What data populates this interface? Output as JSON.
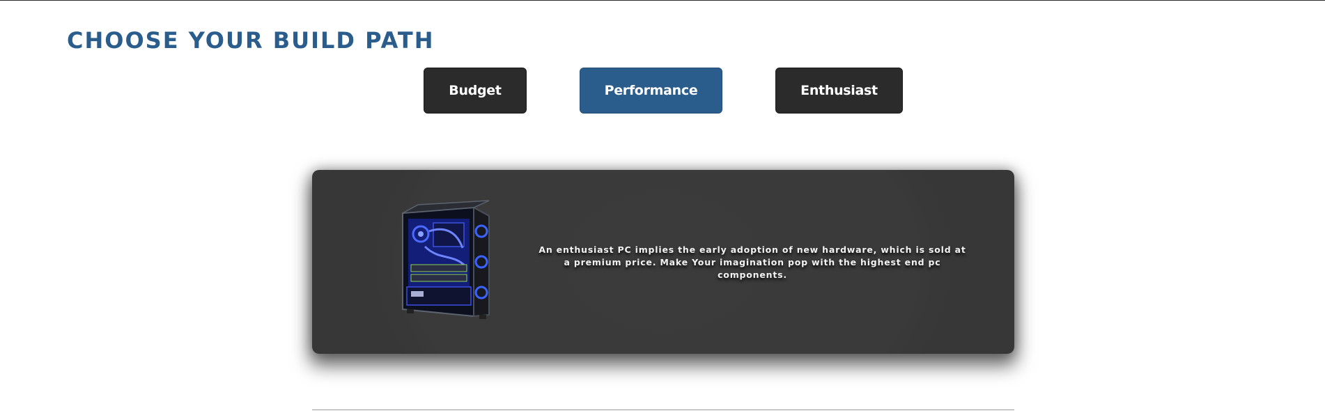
{
  "page": {
    "title": "CHOOSE YOUR BUILD PATH"
  },
  "build_paths": {
    "active": "Performance",
    "items": [
      {
        "label": "Budget"
      },
      {
        "label": "Performance"
      },
      {
        "label": "Enthusiast"
      }
    ]
  },
  "card": {
    "image_icon": "pc-tower-icon",
    "description": "An enthusiast PC implies the early adoption of new hardware, which is sold at a premium price. Make Your imagination pop with the highest end pc components."
  },
  "colors": {
    "accent": "#2b5d8c",
    "button_dark": "#2b2b2b",
    "card_bg": "#3a3a3a",
    "glow": "#2a4dff"
  }
}
